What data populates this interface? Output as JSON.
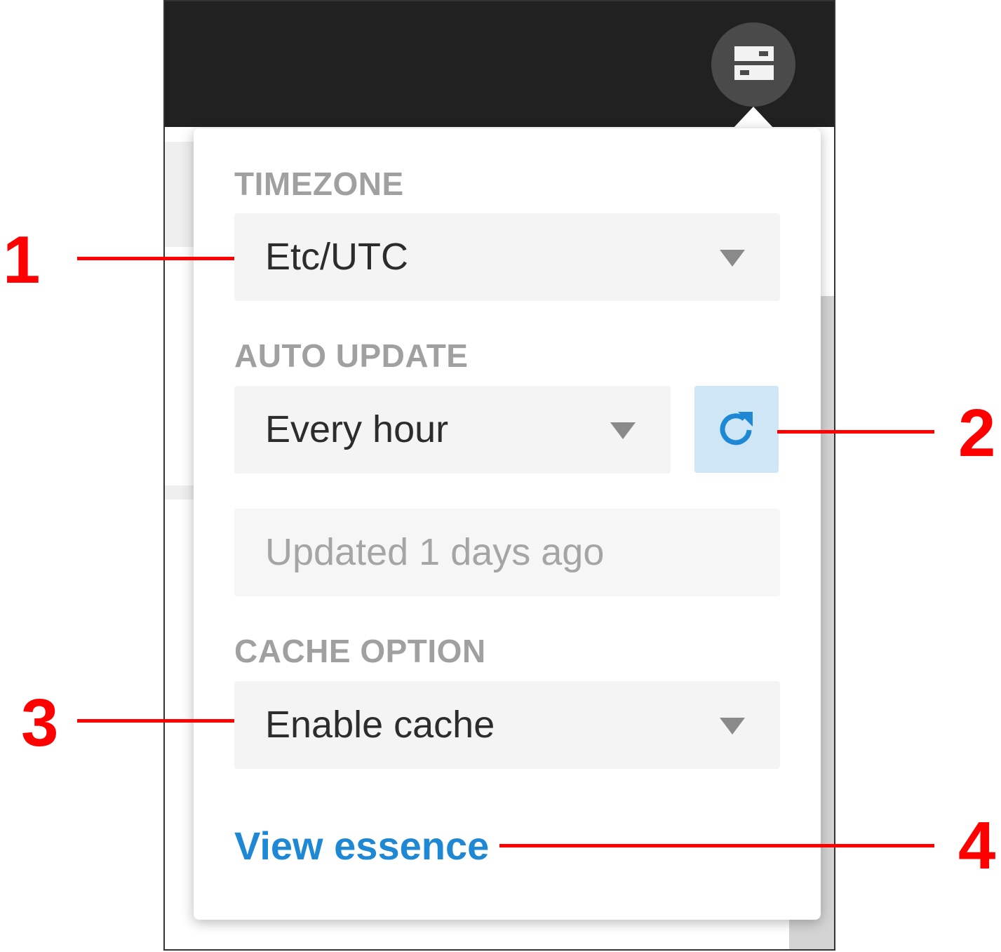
{
  "popover": {
    "timezone": {
      "label": "TIMEZONE",
      "value": "Etc/UTC"
    },
    "auto_update": {
      "label": "AUTO UPDATE",
      "value": "Every hour",
      "status": "Updated 1 days ago"
    },
    "cache_option": {
      "label": "CACHE OPTION",
      "value": "Enable cache"
    },
    "link": "View essence"
  },
  "callouts": [
    "1",
    "2",
    "3",
    "4"
  ],
  "icons": {
    "server": "server-icon",
    "refresh": "refresh-icon",
    "dropdown": "caret-down-icon"
  },
  "colors": {
    "topbar": "#212121",
    "link": "#1e88d4",
    "refresh_bg": "#cfe6f7",
    "refresh_icon": "#1e88d4",
    "callout": "#ff0000"
  }
}
